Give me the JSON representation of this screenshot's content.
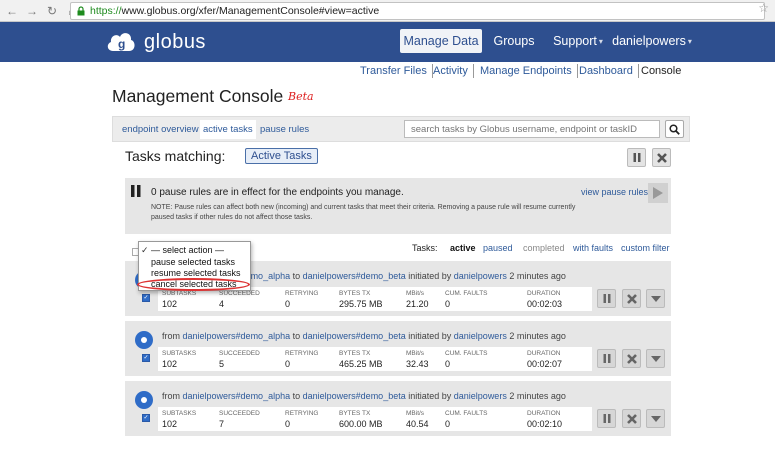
{
  "browser": {
    "url_scheme": "https://",
    "url_rest": "www.globus.org/xfer/ManagementConsole#view=active"
  },
  "header": {
    "logo_text": "globus",
    "nav": {
      "manage_data": "Manage Data",
      "groups": "Groups",
      "support": "Support",
      "user": "danielpowers"
    }
  },
  "subnav": {
    "transfer_files": "Transfer Files",
    "activity": "Activity",
    "manage_endpoints": "Manage Endpoints",
    "dashboard": "Dashboard",
    "console": "Console"
  },
  "page": {
    "title": "Management Console",
    "beta": "Beta"
  },
  "toolbar": {
    "endpoint_overview": "endpoint overview",
    "active_tasks": "active tasks",
    "pause_rules": "pause rules",
    "search_placeholder": "search tasks by Globus username, endpoint or taskID"
  },
  "tasks_header": {
    "label": "Tasks matching:",
    "badge": "Active Tasks"
  },
  "pause_panel": {
    "title": "0 pause rules are in effect for the endpoints you manage.",
    "note": "NOTE: Pause rules can affect both new (incoming) and current tasks that meet their criteria. Removing a pause rule will resume currently paused tasks if other rules do not affect those tasks.",
    "link": "view pause rules"
  },
  "filters": {
    "label": "Tasks:",
    "active": "active",
    "paused": "paused",
    "completed": "completed",
    "with_faults": "with faults",
    "custom_filter": "custom filter"
  },
  "dropdown": {
    "items": [
      "— select action —",
      "pause selected tasks",
      "resume selected tasks",
      "cancel selected tasks"
    ]
  },
  "stat_headers": {
    "subtasks": "SUBTASKS",
    "succeeded": "SUCCEEDED",
    "retrying": "RETRYING",
    "bytes_tx": "BYTES TX",
    "mbits": "MBit/s",
    "faults": "CUM. FAULTS",
    "duration": "DURATION"
  },
  "tasks": [
    {
      "from_label": "from",
      "src": "danielpowers#demo_alpha",
      "to_label": "to",
      "dst": "danielpowers#demo_beta",
      "init_label": "initiated by",
      "user": "danielpowers",
      "when": "2 minutes ago",
      "subtasks": "102",
      "succeeded": "4",
      "retrying": "0",
      "bytes_tx": "295.75 MB",
      "mbits": "21.20",
      "faults": "0",
      "duration": "00:02:03"
    },
    {
      "from_label": "from",
      "src": "danielpowers#demo_alpha",
      "to_label": "to",
      "dst": "danielpowers#demo_beta",
      "init_label": "initiated by",
      "user": "danielpowers",
      "when": "2 minutes ago",
      "subtasks": "102",
      "succeeded": "5",
      "retrying": "0",
      "bytes_tx": "465.25 MB",
      "mbits": "32.43",
      "faults": "0",
      "duration": "00:02:07"
    },
    {
      "from_label": "from",
      "src": "danielpowers#demo_alpha",
      "to_label": "to",
      "dst": "danielpowers#demo_beta",
      "init_label": "initiated by",
      "user": "danielpowers",
      "when": "2 minutes ago",
      "subtasks": "102",
      "succeeded": "7",
      "retrying": "0",
      "bytes_tx": "600.00 MB",
      "mbits": "40.54",
      "faults": "0",
      "duration": "00:02:10"
    }
  ]
}
